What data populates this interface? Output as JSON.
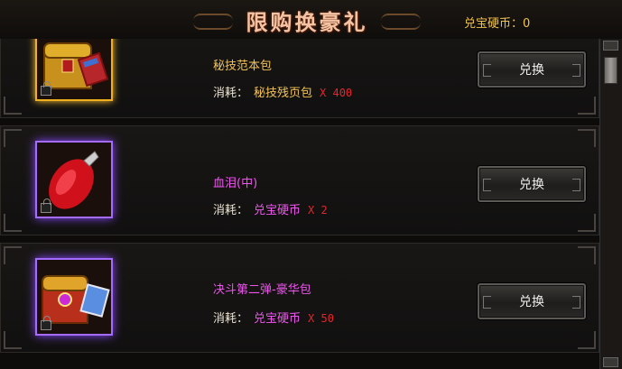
{
  "header": {
    "title": "限购换豪礼",
    "currency_label": "兑宝硬币：",
    "currency_value": "0"
  },
  "items": [
    {
      "name": "秘技范本包",
      "name_color": "#f2c356",
      "cost_label": "消耗：",
      "cost_material": "秘技残页包",
      "cost_material_color": "#f2c356",
      "cost_qty": "X 400",
      "button": "兑换",
      "icon": "treasure-chest-icon",
      "frame": "gold"
    },
    {
      "name": "血泪(中)",
      "name_color": "#ee55ee",
      "cost_label": "消耗：",
      "cost_material": "兑宝硬币",
      "cost_material_color": "#ee55ee",
      "cost_qty": "X 2",
      "button": "兑换",
      "icon": "blood-tear-gem-icon",
      "frame": "purple"
    },
    {
      "name": "决斗第二弹-豪华包",
      "name_color": "#ee55ee",
      "cost_label": "消耗：",
      "cost_material": "兑宝硬币",
      "cost_material_color": "#ee55ee",
      "cost_qty": "X 50",
      "button": "兑换",
      "icon": "deluxe-chest-icon",
      "frame": "purple"
    }
  ]
}
